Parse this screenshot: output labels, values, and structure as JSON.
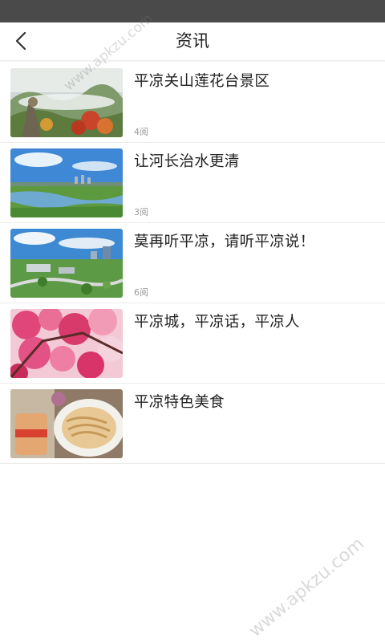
{
  "header": {
    "title": "资讯",
    "back_icon": "chevron-left-icon"
  },
  "news": [
    {
      "title": "平凉关山莲花台景区",
      "reads": "4阅"
    },
    {
      "title": "让河长治水更清",
      "reads": "3阅"
    },
    {
      "title": "莫再听平凉，请听平凉说！",
      "reads": "6阅"
    },
    {
      "title": "平凉城，平凉话，平凉人",
      "reads": ""
    },
    {
      "title": "平凉特色美食",
      "reads": ""
    }
  ],
  "watermark": {
    "text": "www.apkzu.com"
  }
}
